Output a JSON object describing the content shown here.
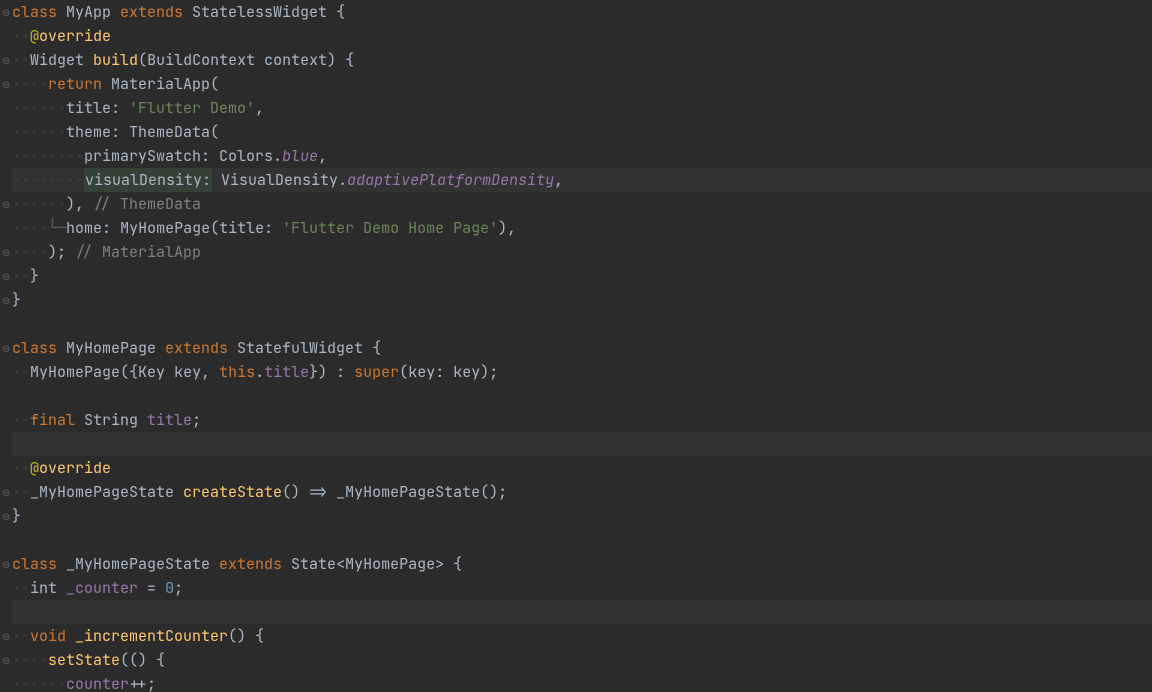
{
  "code": {
    "lines": [
      {
        "gutter": "⊖",
        "hl": false,
        "html": [
          [
            "kw",
            "class "
          ],
          [
            "cls",
            "MyApp "
          ],
          [
            "kw",
            "extends "
          ],
          [
            "cls",
            "StatelessWidget "
          ],
          [
            "pun",
            "{"
          ]
        ]
      },
      {
        "gutter": "",
        "hl": false,
        "html": [
          [
            "ws",
            "··"
          ],
          [
            "anno",
            "@"
          ],
          [
            "fn",
            "override"
          ]
        ]
      },
      {
        "gutter": "⊖",
        "hl": false,
        "html": [
          [
            "ws",
            "··"
          ],
          [
            "cls",
            "Widget "
          ],
          [
            "fn",
            "build"
          ],
          [
            "pun",
            "("
          ],
          [
            "cls",
            "BuildContext "
          ],
          [
            "param",
            "context"
          ],
          [
            "pun",
            ") {"
          ]
        ]
      },
      {
        "gutter": "⊖",
        "hl": false,
        "html": [
          [
            "ws",
            "····"
          ],
          [
            "kw",
            "return "
          ],
          [
            "cls",
            "MaterialApp"
          ],
          [
            "pun",
            "("
          ]
        ]
      },
      {
        "gutter": "",
        "hl": false,
        "html": [
          [
            "ws",
            "······"
          ],
          [
            "param",
            "title: "
          ],
          [
            "str",
            "'Flutter Demo'"
          ],
          [
            "pun",
            ","
          ]
        ]
      },
      {
        "gutter": "",
        "hl": false,
        "html": [
          [
            "ws",
            "······"
          ],
          [
            "param",
            "theme: "
          ],
          [
            "cls",
            "ThemeData"
          ],
          [
            "pun",
            "("
          ]
        ]
      },
      {
        "gutter": "",
        "hl": false,
        "html": [
          [
            "ws",
            "········"
          ],
          [
            "param",
            "primarySwatch: "
          ],
          [
            "cls",
            "Colors"
          ],
          [
            "pun",
            "."
          ],
          [
            "stat",
            "blue"
          ],
          [
            "pun",
            ","
          ]
        ]
      },
      {
        "gutter": "",
        "hl": true,
        "html": [
          [
            "ws",
            "········"
          ],
          [
            "hl2",
            "visualDensity:"
          ],
          [
            "param",
            " "
          ],
          [
            "cls",
            "VisualDensity"
          ],
          [
            "pun",
            "."
          ],
          [
            "stat",
            "adaptivePlatformDensity"
          ],
          [
            "pun",
            ","
          ]
        ]
      },
      {
        "gutter": "⊖",
        "hl": false,
        "html": [
          [
            "ws",
            "······"
          ],
          [
            "pun",
            ")"
          ],
          [
            "pun",
            ", "
          ],
          [
            "com",
            "// ThemeData"
          ]
        ]
      },
      {
        "gutter": "",
        "hl": false,
        "html": [
          [
            "ws",
            "····└─"
          ],
          [
            "param",
            "home: "
          ],
          [
            "cls",
            "MyHomePage"
          ],
          [
            "pun",
            "("
          ],
          [
            "param",
            "title: "
          ],
          [
            "str",
            "'Flutter Demo Home Page'"
          ],
          [
            "pun",
            "),"
          ]
        ]
      },
      {
        "gutter": "⊖",
        "hl": false,
        "html": [
          [
            "ws",
            "····"
          ],
          [
            "pun",
            ")"
          ],
          [
            "pun",
            "; "
          ],
          [
            "com",
            "// MaterialApp"
          ]
        ]
      },
      {
        "gutter": "⊖",
        "hl": false,
        "html": [
          [
            "ws",
            "··"
          ],
          [
            "pun",
            "}"
          ]
        ]
      },
      {
        "gutter": "⊖",
        "hl": false,
        "html": [
          [
            "pun",
            "}"
          ]
        ]
      },
      {
        "gutter": "",
        "hl": false,
        "html": []
      },
      {
        "gutter": "⊖",
        "hl": false,
        "html": [
          [
            "kw",
            "class "
          ],
          [
            "cls",
            "MyHomePage "
          ],
          [
            "kw",
            "extends "
          ],
          [
            "cls",
            "StatefulWidget "
          ],
          [
            "pun",
            "{"
          ]
        ]
      },
      {
        "gutter": "",
        "hl": false,
        "html": [
          [
            "ws",
            "··"
          ],
          [
            "cls",
            "MyHomePage"
          ],
          [
            "pun",
            "({"
          ],
          [
            "cls",
            "Key "
          ],
          [
            "param",
            "key"
          ],
          [
            "pun",
            ", "
          ],
          [
            "kw",
            "this"
          ],
          [
            "pun",
            "."
          ],
          [
            "field",
            "title"
          ],
          [
            "pun",
            "}) : "
          ],
          [
            "kw",
            "super"
          ],
          [
            "pun",
            "("
          ],
          [
            "param",
            "key: "
          ],
          [
            "param",
            "key"
          ],
          [
            "pun",
            ");"
          ]
        ]
      },
      {
        "gutter": "",
        "hl": false,
        "html": []
      },
      {
        "gutter": "",
        "hl": false,
        "html": [
          [
            "ws",
            "··"
          ],
          [
            "kw",
            "final "
          ],
          [
            "cls",
            "String "
          ],
          [
            "field",
            "title"
          ],
          [
            "pun",
            ";"
          ]
        ]
      },
      {
        "gutter": "",
        "hl": true,
        "html": []
      },
      {
        "gutter": "",
        "hl": false,
        "html": [
          [
            "ws",
            "··"
          ],
          [
            "anno",
            "@"
          ],
          [
            "fn",
            "override"
          ]
        ]
      },
      {
        "gutter": "⊖",
        "hl": false,
        "html": [
          [
            "ws",
            "··"
          ],
          [
            "cls",
            "_MyHomePageState "
          ],
          [
            "fn",
            "createState"
          ],
          [
            "pun",
            "() => "
          ],
          [
            "cls",
            "_MyHomePageState"
          ],
          [
            "pun",
            "();"
          ]
        ]
      },
      {
        "gutter": "⊖",
        "hl": false,
        "html": [
          [
            "pun",
            "}"
          ]
        ]
      },
      {
        "gutter": "",
        "hl": false,
        "html": []
      },
      {
        "gutter": "⊖",
        "hl": false,
        "html": [
          [
            "kw",
            "class "
          ],
          [
            "cls",
            "_MyHomePageState "
          ],
          [
            "kw",
            "extends "
          ],
          [
            "cls",
            "State"
          ],
          [
            "pun",
            "<"
          ],
          [
            "cls",
            "MyHomePage"
          ],
          [
            "pun",
            "> {"
          ]
        ]
      },
      {
        "gutter": "",
        "hl": false,
        "html": [
          [
            "ws",
            "··"
          ],
          [
            "cls",
            "int "
          ],
          [
            "field",
            "_counter"
          ],
          [
            "pun",
            " = "
          ],
          [
            "num",
            "0"
          ],
          [
            "pun",
            ";"
          ]
        ]
      },
      {
        "gutter": "",
        "hl": true,
        "html": []
      },
      {
        "gutter": "⊖",
        "hl": false,
        "html": [
          [
            "ws",
            "··"
          ],
          [
            "kw",
            "void "
          ],
          [
            "fn",
            "_incrementCounter"
          ],
          [
            "pun",
            "() {"
          ]
        ]
      },
      {
        "gutter": "⊖",
        "hl": false,
        "html": [
          [
            "ws",
            "····"
          ],
          [
            "fn",
            "setState"
          ],
          [
            "pun",
            "(() {"
          ]
        ]
      },
      {
        "gutter": "",
        "hl": false,
        "html": [
          [
            "ws",
            "······"
          ],
          [
            "field",
            "counter"
          ],
          [
            "pun",
            "++;"
          ]
        ]
      }
    ]
  }
}
